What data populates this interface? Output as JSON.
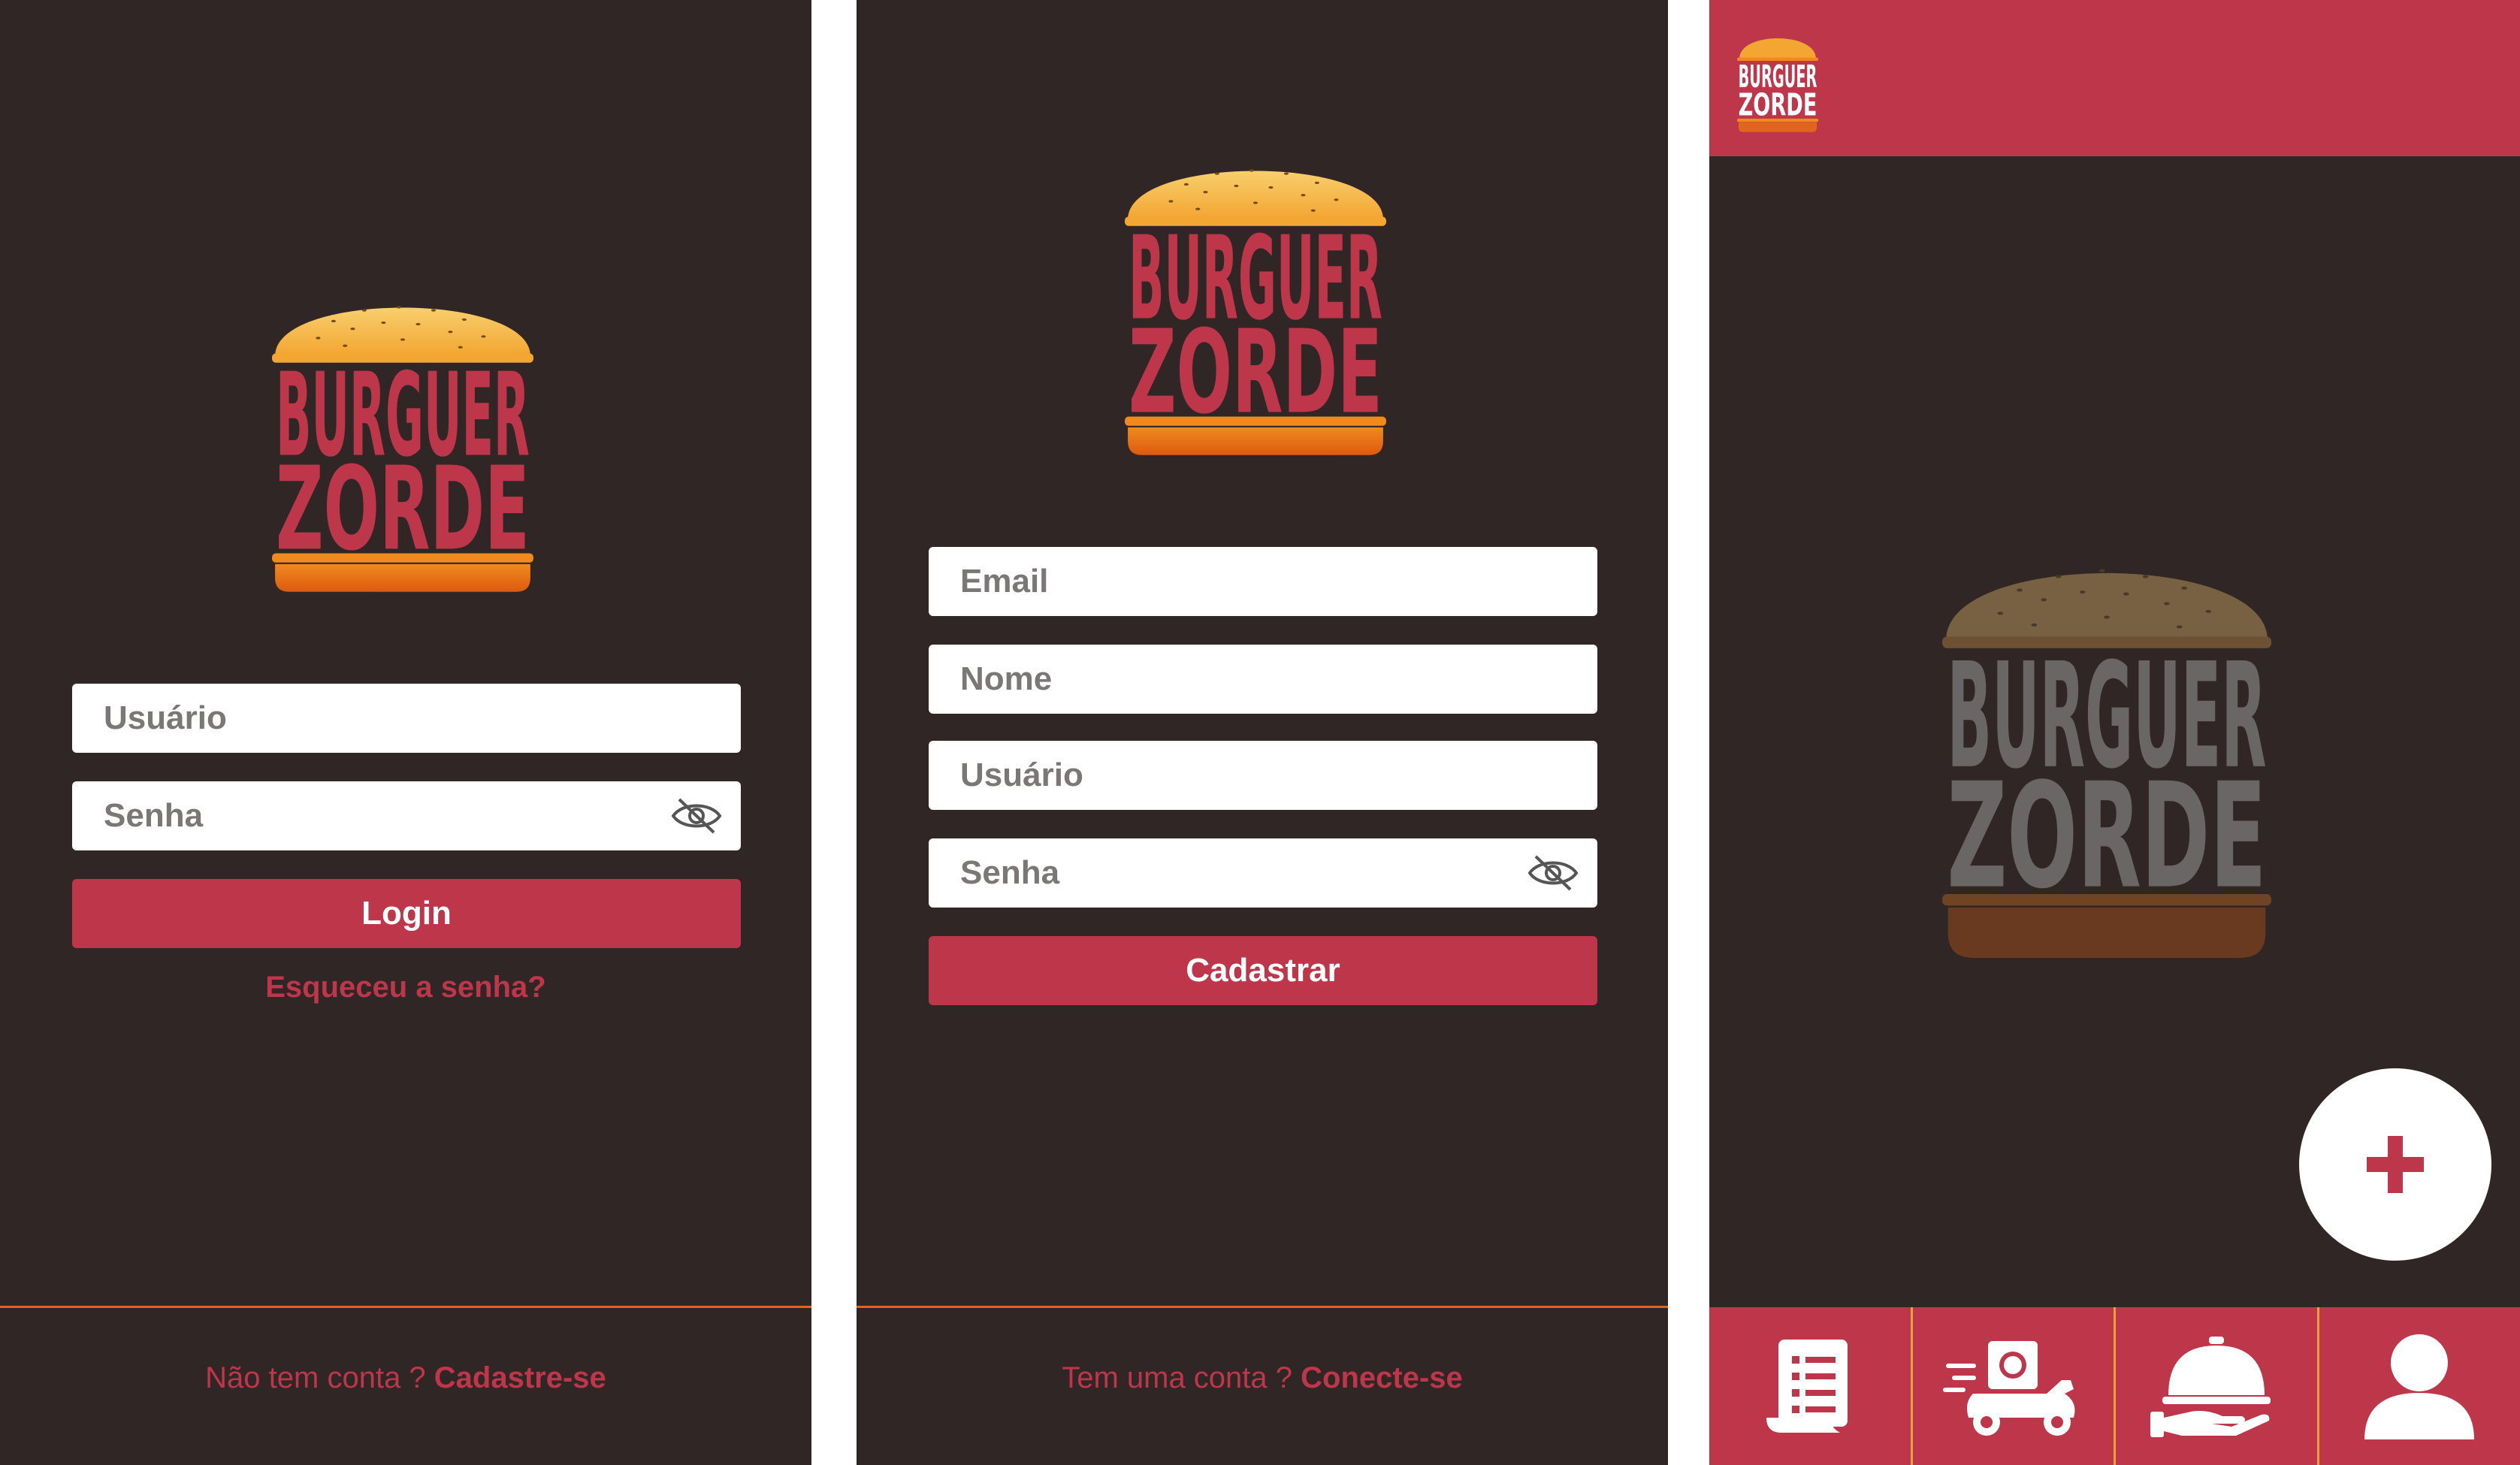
{
  "brand": {
    "line1": "BURGUER",
    "line2": "ZORDE"
  },
  "login": {
    "username_placeholder": "Usuário",
    "password_placeholder": "Senha",
    "login_label": "Login",
    "forgot_label": "Esqueceu a senha?",
    "footer_prefix": "Não tem conta ?",
    "footer_link": "Cadastre-se"
  },
  "signup": {
    "email_placeholder": "Email",
    "name_placeholder": "Nome",
    "username_placeholder": "Usuário",
    "password_placeholder": "Senha",
    "submit_label": "Cadastrar",
    "footer_prefix": "Tem uma conta ?",
    "footer_link": "Conecte-se"
  },
  "home": {
    "nav": [
      {
        "icon": "menu-list-icon"
      },
      {
        "icon": "delivery-scooter-icon"
      },
      {
        "icon": "serving-cloche-icon"
      },
      {
        "icon": "user-profile-icon"
      }
    ]
  },
  "colors": {
    "background": "#312626",
    "accent": "#bd364a",
    "orange": "#e0661d",
    "white": "#ffffff"
  }
}
